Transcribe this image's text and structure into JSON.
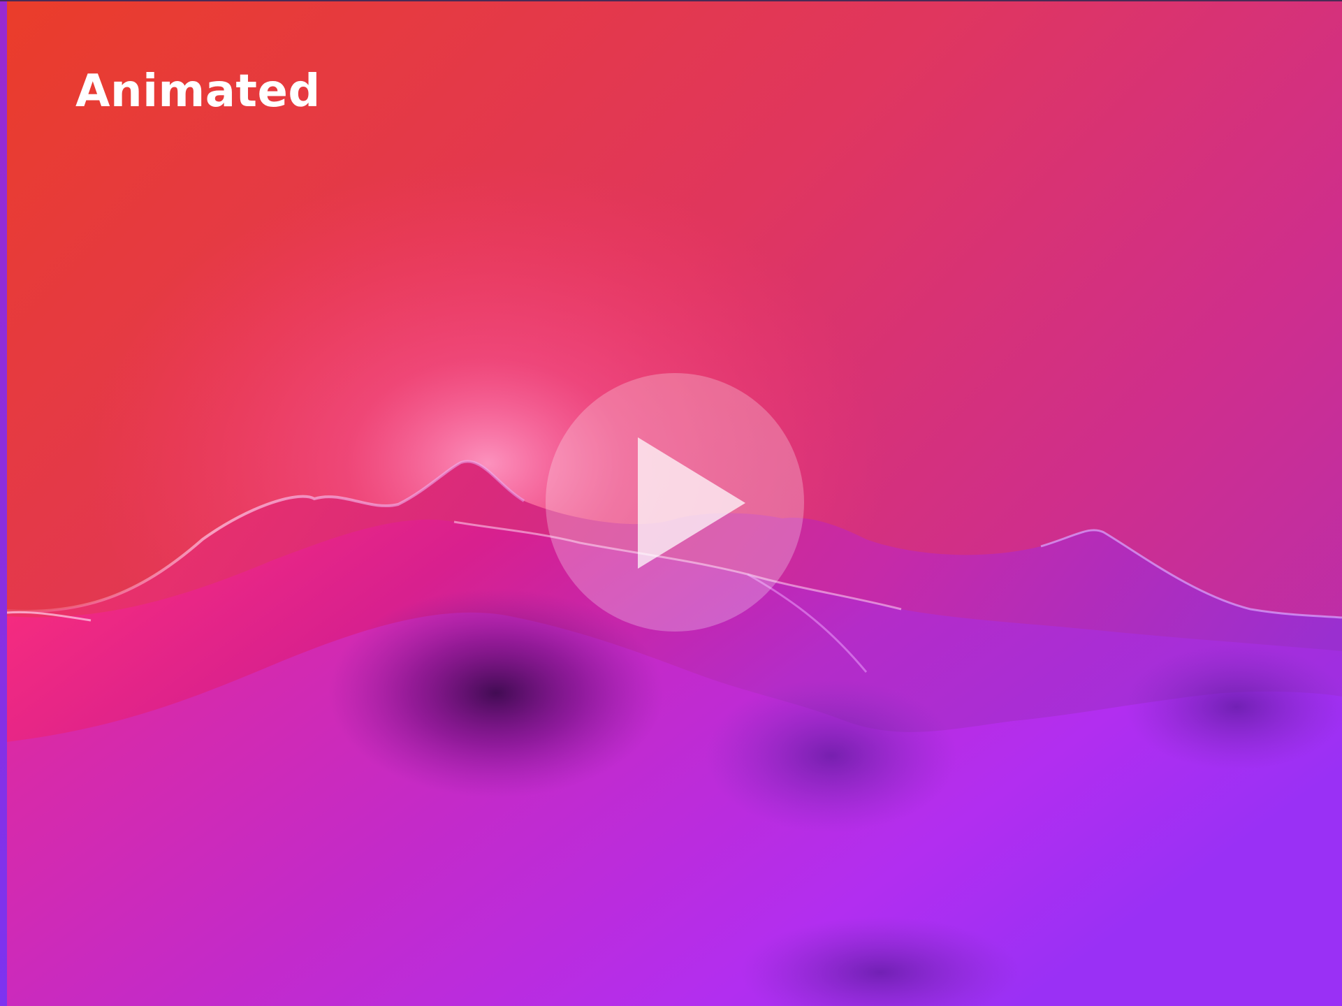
{
  "video_card": {
    "title": "Animated",
    "play_button_icon": "play-icon",
    "colors": {
      "sky_top_left": "#ea3d2a",
      "sky_top_right": "#c22da6",
      "terrain_pink": "#ff2f8a",
      "terrain_purple": "#b22ff0",
      "terrain_shadow": "#3a0a6a",
      "play_overlay": "rgba(255,255,255,0.26)"
    }
  }
}
